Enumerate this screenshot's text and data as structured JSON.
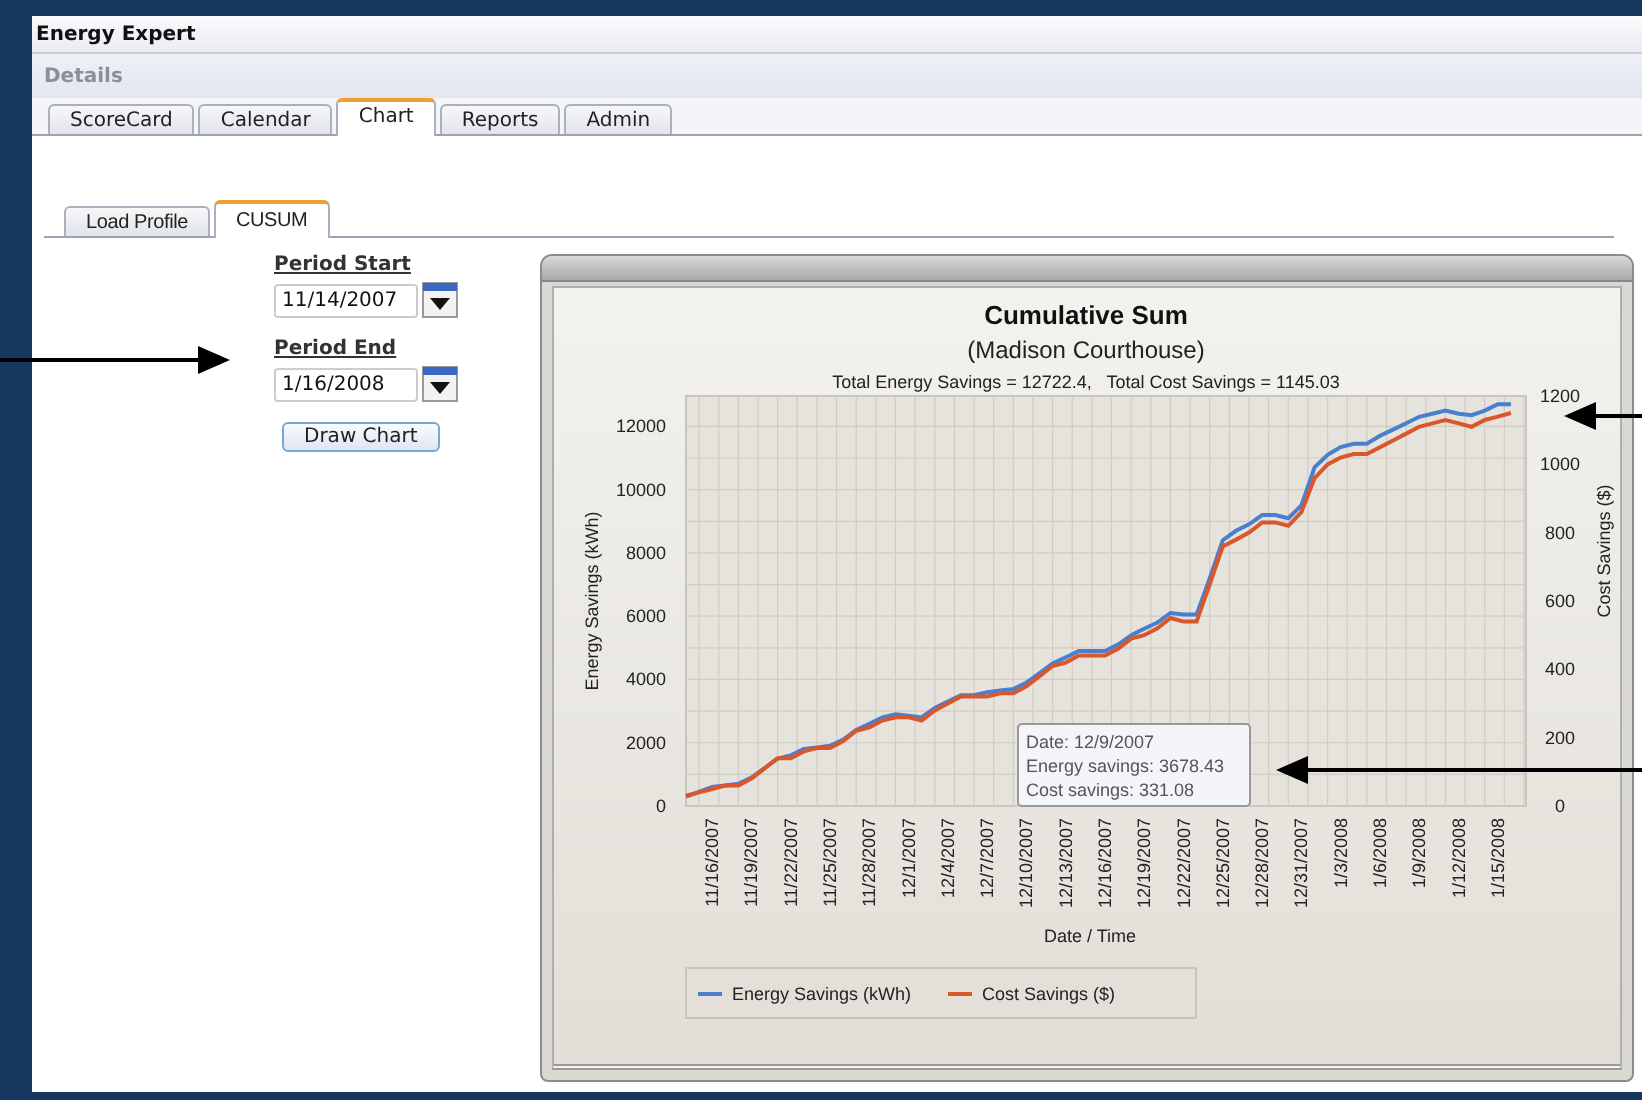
{
  "app": {
    "title": "Energy Expert"
  },
  "section": {
    "title": "Details"
  },
  "tabs": [
    {
      "label": "ScoreCard",
      "selected": false
    },
    {
      "label": "Calendar",
      "selected": false
    },
    {
      "label": "Chart",
      "selected": true
    },
    {
      "label": "Reports",
      "selected": false
    },
    {
      "label": "Admin",
      "selected": false
    }
  ],
  "subtabs": [
    {
      "label": "Load Profile",
      "selected": false
    },
    {
      "label": "CUSUM",
      "selected": true
    }
  ],
  "form": {
    "fields": [
      {
        "label": "Period Start",
        "value": "11/14/2007"
      },
      {
        "label": "Period End",
        "value": "1/16/2008"
      }
    ],
    "button": "Draw Chart"
  },
  "chart": {
    "subtitle": "(Madison Courthouse)",
    "summary": "Total Energy Savings = 12722.4,   Total Cost Savings = 1145.03",
    "tooltip": [
      "Date: 12/9/2007",
      "Energy savings: 3678.43",
      "Cost savings: 331.08"
    ],
    "chart_data": {
      "type": "line",
      "title": "Cumulative Sum",
      "xlabel": "Date / Time",
      "ylabel": "Energy Savings (kWh)",
      "y2label": "Cost Savings ($)",
      "categories": [
        null,
        null,
        "11/16/2007",
        null,
        null,
        "11/19/2007",
        null,
        null,
        "11/22/2007",
        null,
        null,
        "11/25/2007",
        null,
        null,
        "11/28/2007",
        null,
        null,
        "12/1/2007",
        null,
        null,
        "12/4/2007",
        null,
        null,
        "12/7/2007",
        null,
        null,
        "12/10/2007",
        null,
        null,
        "12/13/2007",
        null,
        null,
        "12/16/2007",
        null,
        null,
        "12/19/2007",
        null,
        null,
        "12/22/2007",
        null,
        null,
        "12/25/2007",
        null,
        null,
        "12/28/2007",
        null,
        null,
        "12/31/2007",
        null,
        null,
        "1/3/2008",
        null,
        null,
        "1/6/2008",
        null,
        null,
        "1/9/2008",
        null,
        null,
        "1/12/2008",
        null,
        null,
        "1/15/2008",
        null
      ],
      "series": [
        {
          "name": "Energy Savings (kWh)",
          "color": "#4a7fd0",
          "values": [
            300,
            450,
            600,
            650,
            700,
            900,
            1200,
            1500,
            1600,
            1800,
            1850,
            1900,
            2100,
            2400,
            2600,
            2800,
            2900,
            2850,
            2800,
            3100,
            3300,
            3500,
            3500,
            3600,
            3650,
            3700,
            3900,
            4200,
            4500,
            4700,
            4900,
            4900,
            4900,
            5100,
            5400,
            5600,
            5800,
            6100,
            6050,
            6050,
            7200,
            8400,
            8700,
            8900,
            9200,
            9200,
            9100,
            9500,
            10700,
            11100,
            11350,
            11450,
            11450,
            11700,
            11900,
            12100,
            12300,
            12400,
            12500,
            12400,
            12350,
            12500,
            12700,
            12700
          ]
        },
        {
          "name": "Cost Savings ($)",
          "color": "#d9572a",
          "axis": "y2",
          "values": [
            30,
            40,
            50,
            60,
            60,
            80,
            110,
            140,
            140,
            160,
            170,
            170,
            190,
            220,
            230,
            250,
            260,
            260,
            250,
            280,
            300,
            320,
            320,
            320,
            330,
            330,
            350,
            380,
            410,
            420,
            440,
            440,
            440,
            460,
            490,
            500,
            520,
            550,
            540,
            540,
            650,
            760,
            780,
            800,
            830,
            830,
            820,
            860,
            960,
            1000,
            1020,
            1030,
            1030,
            1050,
            1070,
            1090,
            1110,
            1120,
            1130,
            1120,
            1110,
            1130,
            1140,
            1150
          ]
        }
      ],
      "ylim": [
        0,
        12960
      ],
      "y2lim": [
        0,
        1200
      ],
      "grid": true,
      "legend": true,
      "yticks": [
        0,
        2000,
        4000,
        6000,
        8000,
        10000,
        12000
      ],
      "y2ticks": [
        0,
        200,
        400,
        600,
        800,
        1000,
        1200
      ]
    }
  }
}
